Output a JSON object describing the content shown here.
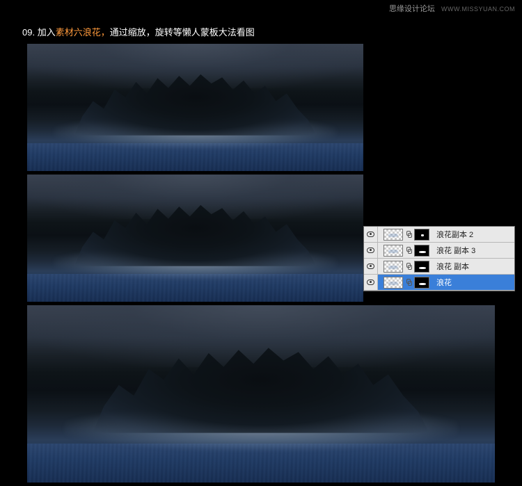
{
  "watermark": {
    "text": "思缘设计论坛",
    "url": "WWW.MISSYUAN.COM"
  },
  "instruction": {
    "step": "09.",
    "pre": "加入",
    "highlight": "素材六浪花，",
    "post": "通过缩放，旋转等懒人蒙板大法看图"
  },
  "layers": {
    "rows": [
      {
        "label": "浪花副本 2",
        "selected": false,
        "maskShape": "dot"
      },
      {
        "label": "浪花 副本 3",
        "selected": false,
        "maskShape": "bar"
      },
      {
        "label": "浪花 副本",
        "selected": false,
        "maskShape": "bar"
      },
      {
        "label": "浪花",
        "selected": true,
        "maskShape": "bar"
      }
    ]
  }
}
